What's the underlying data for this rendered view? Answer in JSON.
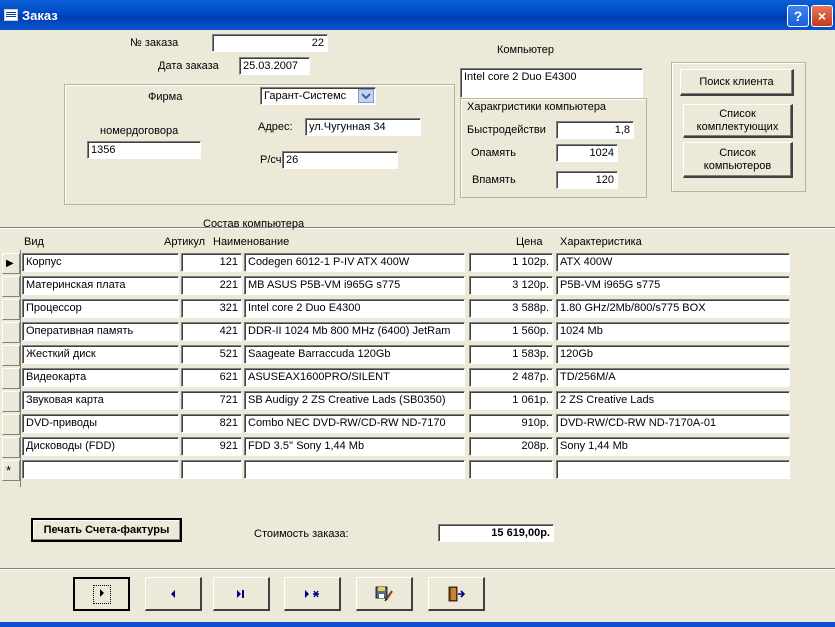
{
  "window": {
    "title": "Заказ",
    "help_label": "?",
    "close_label": "×"
  },
  "order": {
    "number_label": "№ заказа",
    "number": "22",
    "date_label": "Дата заказа",
    "date": "25.03.2007"
  },
  "firm": {
    "firm_label": "Фирма",
    "firm_value": "Гарант-Системс",
    "contract_label": "номердоговора",
    "contract_value": "1356",
    "address_label": "Адрес:",
    "address_value": "ул.Чугунная 34",
    "account_label": "Р/сч:",
    "account_value": "26"
  },
  "computer": {
    "label": "Компьютер",
    "value": "Intel core 2 Duo E4300",
    "specs_label": "Харакгристики компьютера",
    "speed_label": "Быстродействи",
    "speed_value": "1,8",
    "ram_label": "Опамять",
    "ram_value": "1024",
    "hdd_label": "Впамять",
    "hdd_value": "120"
  },
  "buttons": {
    "find_client": "Поиск клиента",
    "components_list": "Список комплектующих",
    "computers_list": "Список компьютеров",
    "print_invoice": "Печать Счета-фактуры"
  },
  "table": {
    "title": "Состав компьютера",
    "headers": {
      "type": "Вид",
      "article": "Артикул",
      "name": "Наименование",
      "price": "Цена",
      "spec": "Характеристика"
    },
    "rows": [
      {
        "type": "Корпус",
        "article": "121",
        "name": "Codegen 6012-1 P-IV ATX 400W",
        "price": "1 102р.",
        "spec": "ATX 400W"
      },
      {
        "type": "Материнская плата",
        "article": "221",
        "name": "MB ASUS P5B-VM i965G s775",
        "price": "3 120р.",
        "spec": "P5B-VM i965G s775"
      },
      {
        "type": "Процессор",
        "article": "321",
        "name": "Intel core 2 Duo E4300",
        "price": "3 588р.",
        "spec": "1.80 GHz/2Mb/800/s775 BOX"
      },
      {
        "type": "Оперативная память",
        "article": "421",
        "name": "DDR-II 1024 Mb 800 MHz (6400) JetRam",
        "price": "1 560р.",
        "spec": "1024 Mb"
      },
      {
        "type": "Жесткий диск",
        "article": "521",
        "name": "Saageate Barraccuda  120Gb",
        "price": "1 583р.",
        "spec": "120Gb"
      },
      {
        "type": "Видеокарта",
        "article": "621",
        "name": "ASUSEAX1600PRO/SILENT",
        "price": "2 487р.",
        "spec": "TD/256M/A"
      },
      {
        "type": "Звуковая карта",
        "article": "721",
        "name": "SB Audigy 2 ZS Creative Lads (SB0350)",
        "price": "1 061р.",
        "spec": "2 ZS Creative Lads"
      },
      {
        "type": "DVD-приводы",
        "article": "821",
        "name": "Combo NEC DVD-RW/CD-RW ND-7170",
        "price": "910р.",
        "spec": "DVD-RW/CD-RW ND-7170A-01"
      },
      {
        "type": "Дисководы (FDD)",
        "article": "921",
        "name": "FDD 3.5'' Sony 1,44 Mb",
        "price": "208р.",
        "spec": "Sony 1,44 Mb"
      }
    ],
    "current_marker": "▶",
    "new_marker": "*"
  },
  "total": {
    "label": "Стоимость заказа:",
    "value": "15 619,00р."
  },
  "icons": [
    "select-next-icon",
    "prev-record-icon",
    "last-record-icon",
    "new-record-icon",
    "save-edit-icon",
    "exit-door-icon"
  ]
}
